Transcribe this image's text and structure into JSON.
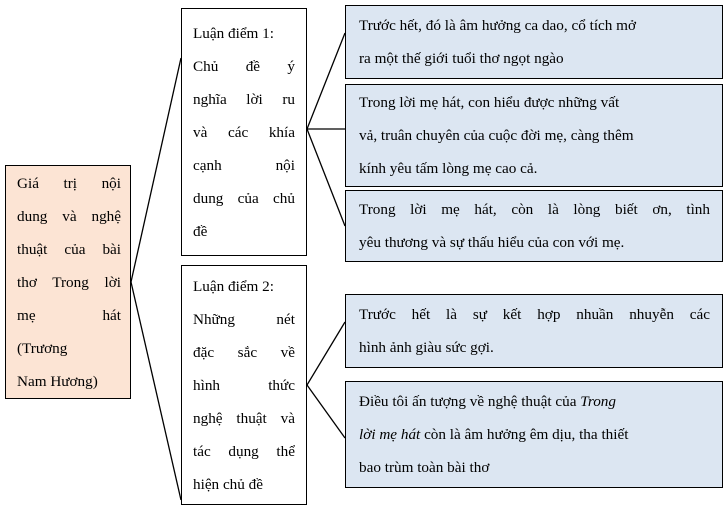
{
  "diagram": {
    "type": "mind-map",
    "direction": "left-to-right",
    "colors": {
      "root_fill": "#fce4d4",
      "claim_fill": "#ffffff",
      "evidence_fill": "#dce6f2",
      "border": "#000000",
      "text": "#000000",
      "background": "#ffffff"
    },
    "root": {
      "id": "root",
      "lines": [
        "Giá trị nội",
        "dung và nghệ",
        "thuật của bài",
        "thơ Trong lời",
        "mẹ hát",
        "(Trương",
        "Nam Hương)"
      ],
      "full_text": "Giá trị nội dung và nghệ thuật của bài thơ Trong lời mẹ hát (Trương Nam Hương)"
    },
    "claims": [
      {
        "id": "claim-1",
        "lines": [
          "Luận điểm 1:",
          "Chủ đề ý",
          "nghĩa lời ru",
          "và các khía",
          "cạnh nội",
          "dung của chủ",
          "đề"
        ],
        "full_text": "Luận điểm 1: Chủ đề ý nghĩa lời ru và các khía cạnh nội dung của chủ đề"
      },
      {
        "id": "claim-2",
        "lines": [
          "Luận điểm 2:",
          "Những nét",
          "đặc sắc về",
          "hình thức",
          "nghệ thuật và",
          "tác dụng thể",
          "hiện chủ đề"
        ],
        "full_text": "Luận điểm 2: Những nét đặc sắc về hình thức nghệ thuật và tác dụng thể hiện chủ đề"
      }
    ],
    "evidence": [
      {
        "id": "ev-1",
        "parent": "claim-1",
        "lines": [
          "Trước hết, đó là âm hưởng ca dao, cổ tích mở",
          "ra một thế giới tuổi thơ ngọt ngào"
        ],
        "full_text": "Trước hết, đó là âm hưởng ca dao, cổ tích mở ra một thế giới tuổi thơ ngọt ngào"
      },
      {
        "id": "ev-2",
        "parent": "claim-1",
        "lines": [
          "Trong lời mẹ hát, con hiểu được những vất",
          "vả, truân chuyên của cuộc đời mẹ, càng thêm",
          "kính yêu tấm lòng mẹ cao cả."
        ],
        "full_text": "Trong lời mẹ hát, con hiểu được những vất vả, truân chuyên của cuộc đời mẹ, càng thêm kính yêu tấm lòng mẹ cao cả."
      },
      {
        "id": "ev-3",
        "parent": "claim-1",
        "lines": [
          "Trong lời mẹ hát, còn là lòng biết ơn, tình",
          "yêu thương và sự thấu hiểu của con với mẹ."
        ],
        "full_text": "Trong lời mẹ hát, còn là lòng biết ơn, tình yêu thương và sự thấu hiểu của con với mẹ."
      },
      {
        "id": "ev-4",
        "parent": "claim-2",
        "lines": [
          "Trước hết là sự kết hợp nhuần nhuyễn các",
          "hình ảnh giàu sức gợi."
        ],
        "full_text": "Trước hết là sự kết hợp nhuần nhuyễn các hình ảnh giàu sức gợi."
      },
      {
        "id": "ev-5",
        "parent": "claim-2",
        "line1_before_italic": "Điều tôi ấn tượng về nghệ thuật của ",
        "line1_italic": "Trong",
        "line2_italic": "lời mẹ hát",
        "line2_after_italic": " còn là âm hưởng êm dịu, tha thiết",
        "line3": "bao trùm toàn bài thơ",
        "full_text": "Điều tôi ấn tượng về nghệ thuật của Trong lời mẹ hát còn là âm hưởng êm dịu, tha thiết bao trùm toàn bài thơ"
      }
    ]
  }
}
